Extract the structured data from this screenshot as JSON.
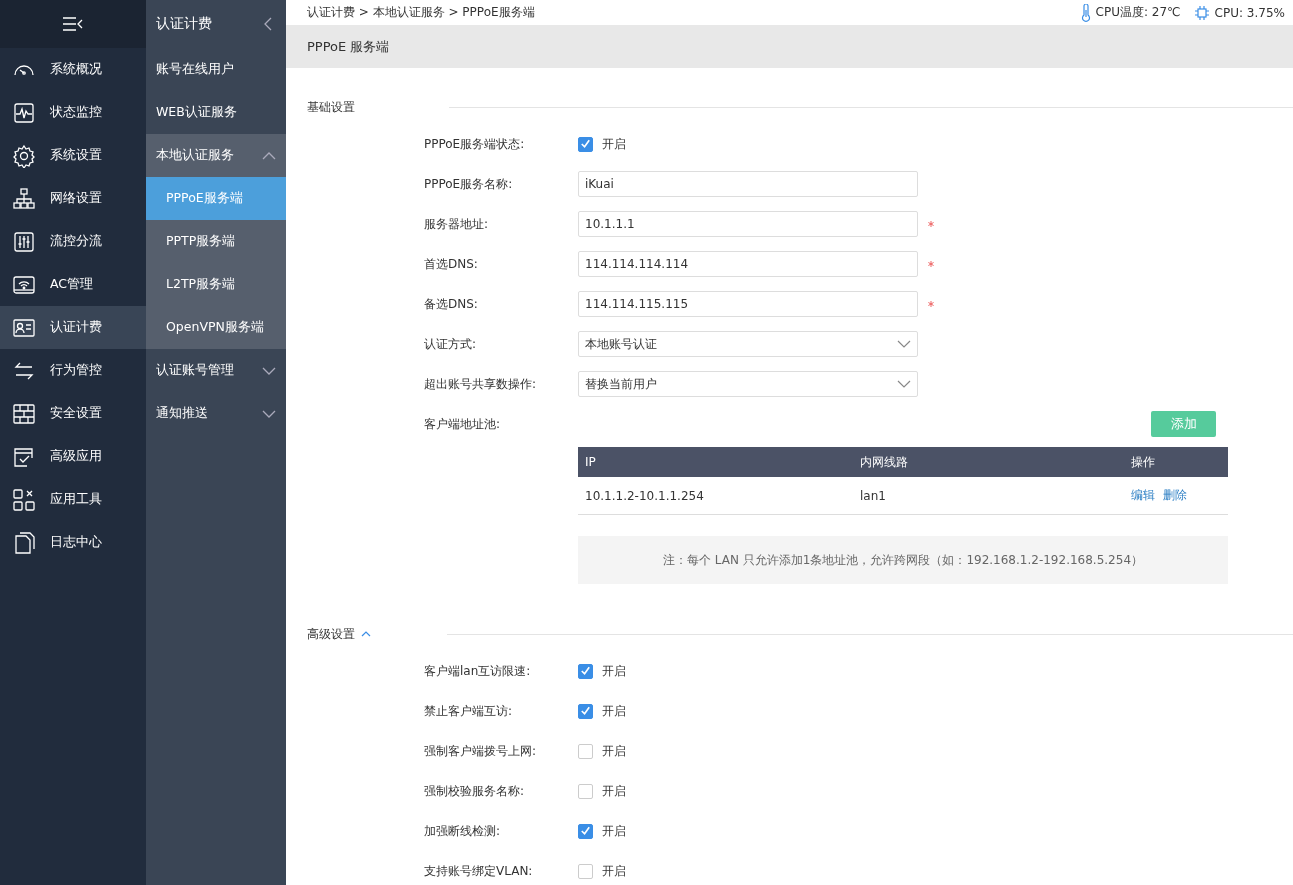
{
  "nav": {
    "items": [
      {
        "label": "系统概况",
        "selected": false
      },
      {
        "label": "状态监控",
        "selected": false
      },
      {
        "label": "系统设置",
        "selected": false
      },
      {
        "label": "网络设置",
        "selected": false
      },
      {
        "label": "流控分流",
        "selected": false
      },
      {
        "label": "AC管理",
        "selected": false
      },
      {
        "label": "认证计费",
        "selected": true
      },
      {
        "label": "行为管控",
        "selected": false
      },
      {
        "label": "安全设置",
        "selected": false
      },
      {
        "label": "高级应用",
        "selected": false
      },
      {
        "label": "应用工具",
        "selected": false
      },
      {
        "label": "日志中心",
        "selected": false
      }
    ]
  },
  "subnav": {
    "title": "认证计费",
    "items": [
      {
        "label": "账号在线用户",
        "kind": "link"
      },
      {
        "label": "WEB认证服务",
        "kind": "link"
      },
      {
        "label": "本地认证服务",
        "kind": "group",
        "expanded": true,
        "children": [
          {
            "label": "PPPoE服务端",
            "selected": true
          },
          {
            "label": "PPTP服务端",
            "selected": false
          },
          {
            "label": "L2TP服务端",
            "selected": false
          },
          {
            "label": "OpenVPN服务端",
            "selected": false
          }
        ]
      },
      {
        "label": "认证账号管理",
        "kind": "group",
        "expanded": false
      },
      {
        "label": "通知推送",
        "kind": "group",
        "expanded": false
      }
    ]
  },
  "breadcrumb": "认证计费 > 本地认证服务 > PPPoE服务端",
  "status": {
    "cpu_temp": "CPU温度: 27℃",
    "cpu": "CPU: 3.75%"
  },
  "page_title": "PPPoE 服务端",
  "basic": {
    "title": "基础设置",
    "fields": [
      {
        "kind": "checkbox",
        "label": "PPPoE服务端状态:",
        "checked": true,
        "text": "开启"
      },
      {
        "kind": "input",
        "label": "PPPoE服务名称:",
        "value": "iKuai",
        "required": false
      },
      {
        "kind": "input",
        "label": "服务器地址:",
        "value": "10.1.1.1",
        "required": true
      },
      {
        "kind": "input",
        "label": "首选DNS:",
        "value": "114.114.114.114",
        "required": true
      },
      {
        "kind": "input",
        "label": "备选DNS:",
        "value": "114.114.115.115",
        "required": true
      },
      {
        "kind": "select",
        "label": "认证方式:",
        "value": "本地账号认证"
      },
      {
        "kind": "select",
        "label": "超出账号共享数操作:",
        "value": "替换当前用户"
      }
    ],
    "pool": {
      "label": "客户端地址池:",
      "add_button": "添加",
      "columns": [
        "IP",
        "内网线路",
        "操作"
      ],
      "rows": [
        {
          "ip": "10.1.1.2-10.1.1.254",
          "line": "lan1",
          "actions": [
            "编辑",
            "删除"
          ]
        }
      ],
      "note": "注：每个 LAN 只允许添加1条地址池，允许跨网段（如：192.168.1.2-192.168.5.254）"
    }
  },
  "advanced": {
    "title": "高级设置",
    "expanded": true,
    "fields": [
      {
        "label": "客户端lan互访限速:",
        "checked": true,
        "text": "开启"
      },
      {
        "label": "禁止客户端互访:",
        "checked": true,
        "text": "开启"
      },
      {
        "label": "强制客户端拨号上网:",
        "checked": false,
        "text": "开启"
      },
      {
        "label": "强制校验服务名称:",
        "checked": false,
        "text": "开启"
      },
      {
        "label": "加强断线检测:",
        "checked": true,
        "text": "开启"
      },
      {
        "label": "支持账号绑定VLAN:",
        "checked": false,
        "text": "开启"
      }
    ]
  }
}
